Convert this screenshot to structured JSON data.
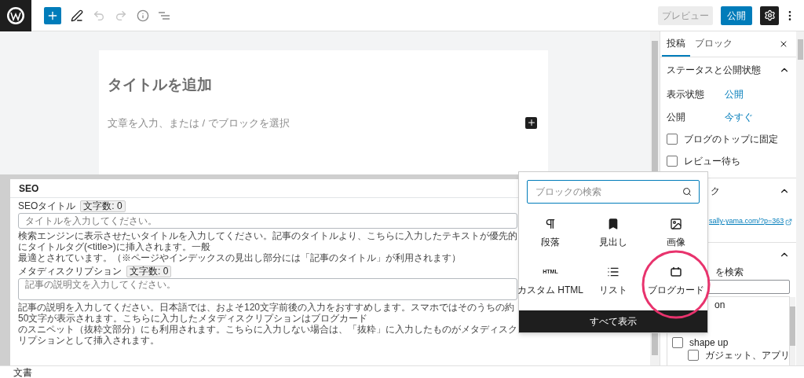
{
  "toolbar": {
    "inserter": {
      "open": true
    },
    "tools": [
      {
        "kind": "pen",
        "disabled": false
      },
      {
        "kind": "undo",
        "disabled": true
      },
      {
        "kind": "redo",
        "disabled": true
      },
      {
        "kind": "info",
        "disabled": false
      },
      {
        "kind": "outline",
        "disabled": false
      }
    ],
    "preview_button": "プレビュー",
    "publish_button": "公開",
    "settings": {
      "pressed": true
    }
  },
  "editor": {
    "title_placeholder": "タイトルを追加",
    "body_placeholder": "文章を入力、または / でブロックを選択"
  },
  "seo": {
    "title": "SEO",
    "fields": [
      {
        "kind": "input",
        "label": "SEOタイトル",
        "count": "文字数: 0",
        "placeholder": "タイトルを入力してください。",
        "help": [
          "検索エンジンに表示させたいタイトルを入力してください。記事のタイトルより、こちらに入力したテキストが優先的にタイトルタグ(<title>)に挿入されます。一般",
          "最適とされています。（※ページやインデックスの見出し部分には「記事のタイトル」が利用されます）"
        ]
      },
      {
        "kind": "textarea",
        "label": "メタディスクリプション",
        "count": "文字数: 0",
        "placeholder": "記事の説明文を入力してください。",
        "help": [
          "記事の説明を入力してください。日本語では、およそ120文字前後の入力をおすすめします。スマホではそのうちの約50文字が表示されます。こちらに入力したメタディスクリプションはブログカード",
          "のスニペット（抜粋文部分）にも利用されます。こちらに入力しない場合は、「抜粋」に入力したものがメタディスクリプションとして挿入されます。"
        ]
      }
    ]
  },
  "sidebar": {
    "tabs": [
      {
        "label": "投稿",
        "selected": true
      },
      {
        "label": "ブロック",
        "selected": false
      }
    ],
    "status_panel": {
      "title": "ステータスと公開状態",
      "expanded": true,
      "rows": [
        {
          "label": "表示状態",
          "value": "公開"
        },
        {
          "label": "公開",
          "value": "今すぐ"
        }
      ],
      "checkboxes": [
        {
          "label": "ブログのトップに固定",
          "checked": false
        },
        {
          "label": "レビュー待ち",
          "checked": false
        }
      ]
    },
    "permalink_panel": {
      "title": "ク",
      "expanded": true,
      "link": "sally-yama.com/?p=363"
    },
    "category_panel": {
      "expanded": true,
      "search_label": "を検索",
      "terms": [
        {
          "label": "on"
        },
        {
          "label": "shape up",
          "checked": false,
          "children": [
            {
              "label": "ガジェット、アプリ",
              "checked": false
            }
          ]
        }
      ]
    }
  },
  "inserter": {
    "search_placeholder": "ブロックの検索",
    "blocks": [
      {
        "kind": "paragraph",
        "label": "段落"
      },
      {
        "kind": "heading",
        "label": "見出し"
      },
      {
        "kind": "image",
        "label": "画像"
      },
      {
        "kind": "html",
        "label": "カスタム HTML",
        "icon_text": "HTML"
      },
      {
        "kind": "list",
        "label": "リスト"
      },
      {
        "kind": "card",
        "label": "ブログカード",
        "highlighted": true
      }
    ],
    "browse_all": "すべて表示"
  },
  "footer": {
    "breadcrumb": "文書"
  }
}
